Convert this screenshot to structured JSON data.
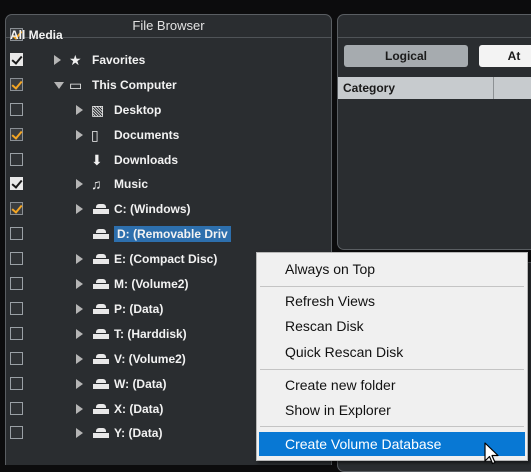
{
  "file_browser": {
    "title": "File Browser",
    "items": [
      {
        "label": "All Media",
        "check": "orange",
        "arrow": "none",
        "icon": "none",
        "depth": 0
      },
      {
        "label": "Favorites",
        "check": "white",
        "arrow": "right",
        "icon": "star-icon",
        "depth": 1
      },
      {
        "label": "This Computer",
        "check": "orange",
        "arrow": "down",
        "icon": "monitor-icon",
        "depth": 1
      },
      {
        "label": "Desktop",
        "check": "none",
        "arrow": "right",
        "icon": "desktop-icon",
        "depth": 2
      },
      {
        "label": "Documents",
        "check": "orange",
        "arrow": "right",
        "icon": "document-icon",
        "depth": 2
      },
      {
        "label": "Downloads",
        "check": "none",
        "arrow": "none",
        "icon": "download-icon",
        "depth": 2
      },
      {
        "label": "Music",
        "check": "white",
        "arrow": "right",
        "icon": "music-icon",
        "depth": 2
      },
      {
        "label": "C: (Windows)",
        "check": "orange",
        "arrow": "right",
        "icon": "drive-icon",
        "depth": 2
      },
      {
        "label": "D: (Removable Driv",
        "check": "none",
        "arrow": "none",
        "icon": "drive-icon",
        "depth": 2,
        "selected": true
      },
      {
        "label": "E: (Compact Disc)",
        "check": "none",
        "arrow": "right",
        "icon": "drive-icon",
        "depth": 2
      },
      {
        "label": "M: (Volume2)",
        "check": "none",
        "arrow": "right",
        "icon": "drive-icon",
        "depth": 2
      },
      {
        "label": "P: (Data)",
        "check": "none",
        "arrow": "right",
        "icon": "drive-icon",
        "depth": 2
      },
      {
        "label": "T: (Harddisk)",
        "check": "none",
        "arrow": "right",
        "icon": "drive-icon",
        "depth": 2
      },
      {
        "label": "V: (Volume2)",
        "check": "none",
        "arrow": "right",
        "icon": "drive-icon",
        "depth": 2
      },
      {
        "label": "W: (Data)",
        "check": "none",
        "arrow": "right",
        "icon": "drive-icon",
        "depth": 2
      },
      {
        "label": "X: (Data)",
        "check": "none",
        "arrow": "right",
        "icon": "drive-icon",
        "depth": 2
      },
      {
        "label": "Y: (Data)",
        "check": "none",
        "arrow": "right",
        "icon": "drive-icon",
        "depth": 2
      }
    ]
  },
  "right_panel": {
    "tab_logical": "Logical",
    "tab_attributes": "At",
    "category_header": "Category"
  },
  "context_menu": {
    "items": [
      {
        "label": "Always on Top"
      },
      {
        "label": "Refresh Views"
      },
      {
        "label": "Rescan Disk"
      },
      {
        "label": "Quick Rescan Disk"
      },
      {
        "label": "Create new folder"
      },
      {
        "label": "Show in Explorer"
      },
      {
        "label": "Create Volume Database",
        "highlighted": true
      }
    ]
  },
  "colors": {
    "check_orange": "#f5a623",
    "selection_blue": "#2d6fad",
    "menu_highlight": "#0878d4"
  }
}
